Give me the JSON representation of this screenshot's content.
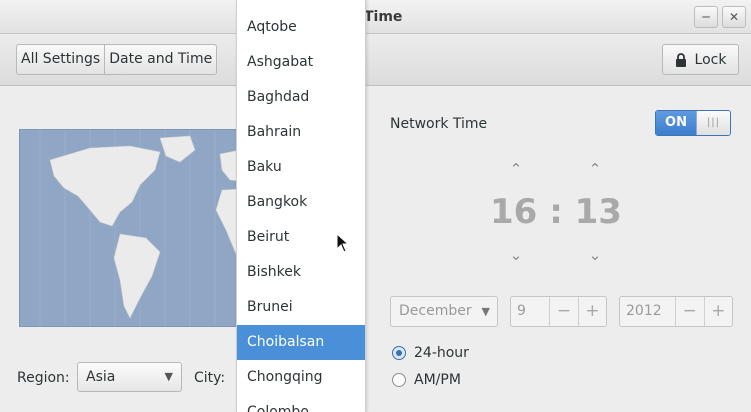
{
  "window": {
    "title": "Time"
  },
  "toolbar": {
    "breadcrumbs": [
      "All Settings",
      "Date and Time"
    ],
    "lock_label": "Lock"
  },
  "location": {
    "region_label": "Region:",
    "region_value": "Asia",
    "city_label": "City:"
  },
  "network_time": {
    "label": "Network Time",
    "switch_state": "ON"
  },
  "clock": {
    "hours": "16",
    "separator": ":",
    "minutes": "13"
  },
  "date": {
    "month": "December",
    "day": "9",
    "year": "2012"
  },
  "time_format": {
    "options": [
      "24-hour",
      "AM/PM"
    ],
    "selected": "24-hour"
  },
  "city_dropdown": {
    "items": [
      "Aqtobe",
      "Ashgabat",
      "Baghdad",
      "Bahrain",
      "Baku",
      "Bangkok",
      "Beirut",
      "Bishkek",
      "Brunei",
      "Choibalsan",
      "Chongqing",
      "Colombo"
    ],
    "highlighted": "Choibalsan"
  },
  "colors": {
    "accent": "#4a90d9",
    "map_ocean": "#8fa6c4",
    "map_land": "#ebebeb"
  }
}
